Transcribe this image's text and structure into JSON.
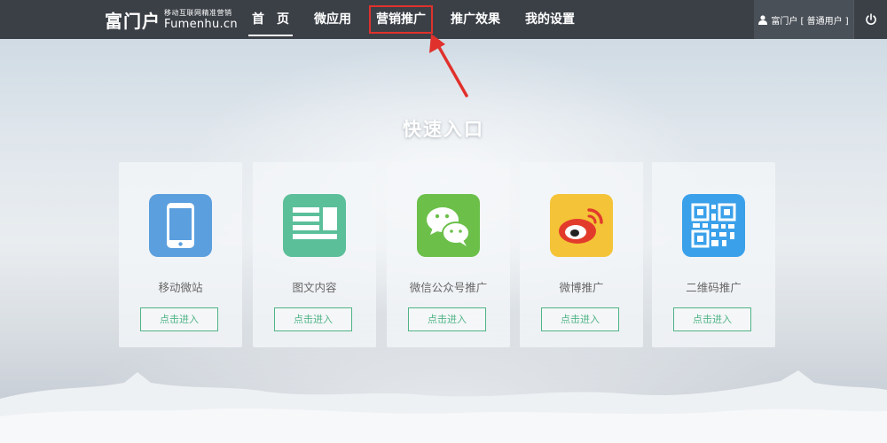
{
  "header": {
    "logo_cn": "富门户",
    "logo_slogan": "移动互联网精准营销",
    "logo_en": "Fumenhu.cn",
    "nav": [
      {
        "label": "首　页",
        "active": true
      },
      {
        "label": "微应用",
        "active": false
      },
      {
        "label": "营销推广",
        "active": false,
        "highlighted": true
      },
      {
        "label": "推广效果",
        "active": false
      },
      {
        "label": "我的设置",
        "active": false
      }
    ],
    "user_label": "富门户 [ 普通用户 ]",
    "power_icon": "power-icon"
  },
  "main": {
    "title": "快速入口",
    "cards": [
      {
        "label": "移动微站",
        "button": "点击进入",
        "icon": "mobile-phone-icon",
        "color": "#5b9fde"
      },
      {
        "label": "图文内容",
        "button": "点击进入",
        "icon": "article-icon",
        "color": "#5bbf9a"
      },
      {
        "label": "微信公众号推广",
        "button": "点击进入",
        "icon": "wechat-icon",
        "color": "#6cc04a"
      },
      {
        "label": "微博推广",
        "button": "点击进入",
        "icon": "weibo-icon",
        "color": "#f4c337"
      },
      {
        "label": "二维码推广",
        "button": "点击进入",
        "icon": "qr-code-icon",
        "color": "#3aa0ea"
      }
    ]
  },
  "colors": {
    "topbar": "#3b4047",
    "accent_green": "#4fb486",
    "highlight_red": "#e0312c"
  }
}
